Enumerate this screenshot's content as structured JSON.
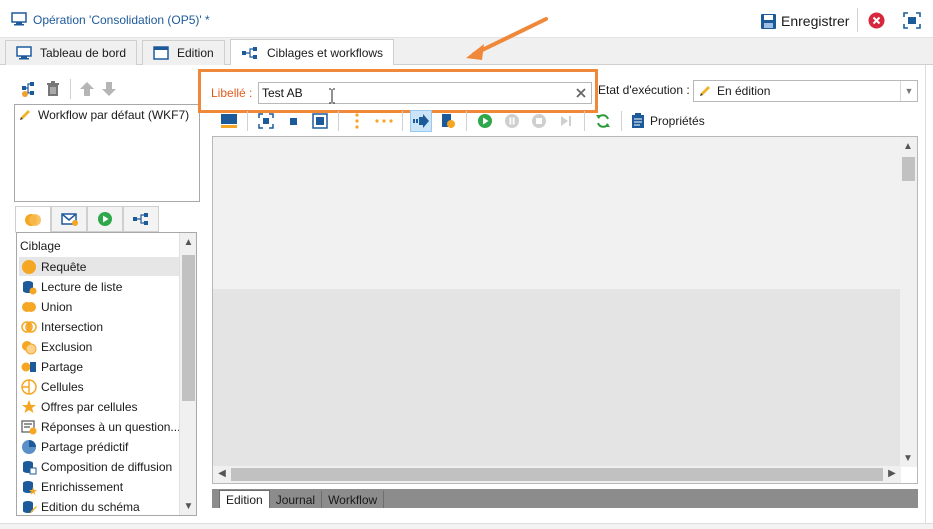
{
  "titlebar": {
    "title": "Opération 'Consolidation (OP5)' *",
    "save_label": "Enregistrer",
    "icons": [
      "operation-icon",
      "save-icon",
      "close-icon",
      "fit-screen-icon"
    ]
  },
  "tabs": [
    {
      "label": "Tableau de bord",
      "icon": "dashboard-icon",
      "active": false
    },
    {
      "label": "Edition",
      "icon": "edition-icon",
      "active": false
    },
    {
      "label": "Ciblages et workflows",
      "icon": "workflow-icon",
      "active": true
    }
  ],
  "left_toolbar": {
    "icons": [
      "new-workflow-icon",
      "delete-icon",
      "move-up-icon",
      "move-down-icon"
    ]
  },
  "workflows": [
    {
      "label": "Workflow par défaut (WKF7)",
      "icon": "pencil-icon"
    }
  ],
  "palette_tabs": [
    {
      "icon": "targeting-icon",
      "active": true
    },
    {
      "icon": "channels-icon",
      "active": false
    },
    {
      "icon": "flow-control-icon",
      "active": false
    },
    {
      "icon": "actions-icon",
      "active": false
    }
  ],
  "palette": {
    "section": "Ciblage",
    "items": [
      {
        "label": "Requête",
        "selected": true
      },
      {
        "label": "Lecture de liste",
        "selected": false
      },
      {
        "label": "Union",
        "selected": false
      },
      {
        "label": "Intersection",
        "selected": false
      },
      {
        "label": "Exclusion",
        "selected": false
      },
      {
        "label": "Partage",
        "selected": false
      },
      {
        "label": "Cellules",
        "selected": false
      },
      {
        "label": "Offres par cellules",
        "selected": false
      },
      {
        "label": "Réponses à un question...",
        "selected": false
      },
      {
        "label": "Partage prédictif",
        "selected": false
      },
      {
        "label": "Composition de diffusion",
        "selected": false
      },
      {
        "label": "Enrichissement",
        "selected": false
      },
      {
        "label": "Edition du schéma",
        "selected": false
      }
    ]
  },
  "label_field": {
    "label": "Libellé :",
    "value": "Test AB"
  },
  "execution_state": {
    "label": "Etat d'exécution :",
    "value": "En édition"
  },
  "workflow_toolbar": {
    "properties_label": "Propriétés"
  },
  "bottom_tabs": [
    {
      "label": "Edition",
      "active": true
    },
    {
      "label": "Journal",
      "active": false
    },
    {
      "label": "Workflow",
      "active": false
    }
  ],
  "colors": {
    "highlight_box": "#f0883a",
    "label_text": "#e05a1e",
    "title_text": "#1d5a9a",
    "start_green": "#2ea84a",
    "refresh_green": "#2e9b3a"
  }
}
